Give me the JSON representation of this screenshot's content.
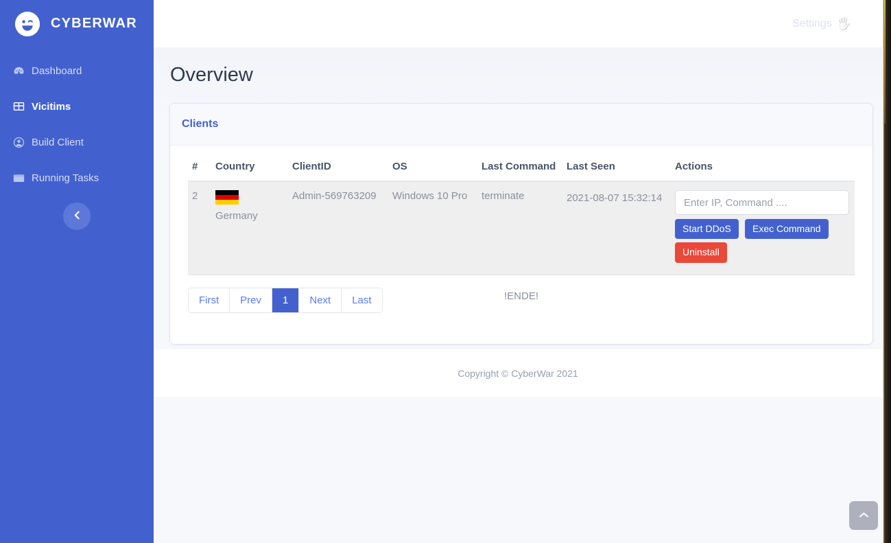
{
  "brand": {
    "name": "CYBERWAR",
    "logo_icon": "wink-smiley-icon"
  },
  "sidebar": {
    "items": [
      {
        "label": "Dashboard",
        "icon": "tachometer-icon",
        "active": false
      },
      {
        "label": "Vicitims",
        "icon": "table-grid-icon",
        "active": true
      },
      {
        "label": "Build Client",
        "icon": "user-circle-icon",
        "active": false
      },
      {
        "label": "Running Tasks",
        "icon": "window-icon",
        "active": false
      }
    ],
    "collapse_icon": "chevron-left-icon"
  },
  "topbar": {
    "settings_label": "Settings",
    "settings_icon": "raised-hand-icon"
  },
  "page": {
    "title": "Overview"
  },
  "card": {
    "title": "Clients"
  },
  "table": {
    "headers": [
      "#",
      "Country",
      "ClientID",
      "OS",
      "Last Command",
      "Last Seen",
      "Actions"
    ],
    "rows": [
      {
        "index": "2",
        "country": "Germany",
        "country_flag": "flag-de",
        "client_id": "Admin-569763209",
        "os": "Windows 10 Pro",
        "last_command": "terminate",
        "last_seen": "2021-08-07 15:32:14",
        "command_placeholder": "Enter IP, Command ....",
        "command_value": "",
        "buttons": [
          {
            "label": "Start DDoS",
            "style": "primary"
          },
          {
            "label": "Exec Command",
            "style": "primary"
          },
          {
            "label": "Uninstall",
            "style": "danger"
          }
        ]
      }
    ]
  },
  "pagination": {
    "items": [
      {
        "label": "First",
        "active": false
      },
      {
        "label": "Prev",
        "active": false
      },
      {
        "label": "1",
        "active": true
      },
      {
        "label": "Next",
        "active": false
      },
      {
        "label": "Last",
        "active": false
      }
    ]
  },
  "end_marker": "!ENDE!",
  "footer": {
    "copyright": "Copyright © CyberWar 2021"
  },
  "scroll_top": {
    "icon": "chevron-up-icon"
  },
  "colors": {
    "sidebar_blue": "#4361ce",
    "accent_blue": "#4361ce",
    "danger_red": "#e9483a",
    "page_bg": "#f7f8fc",
    "row_bg": "#efefef"
  }
}
